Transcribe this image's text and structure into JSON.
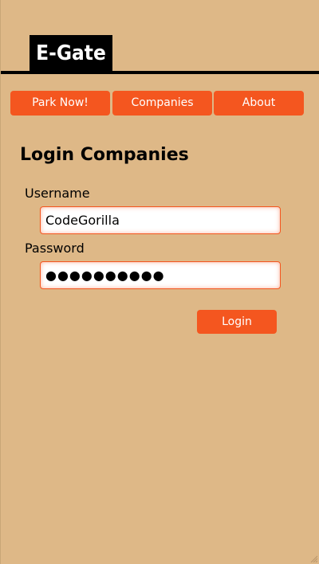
{
  "header": {
    "logo_text": "E-Gate"
  },
  "nav": {
    "items": [
      {
        "label": "Park Now!"
      },
      {
        "label": "Companies"
      },
      {
        "label": "About"
      }
    ]
  },
  "form": {
    "title": "Login Companies",
    "username_label": "Username",
    "username_value": "CodeGorilla",
    "password_label": "Password",
    "password_value": "●●●●●●●●●●",
    "login_label": "Login"
  },
  "colors": {
    "background": "#deb887",
    "accent": "#f4561f",
    "logo_bg": "#000000"
  }
}
